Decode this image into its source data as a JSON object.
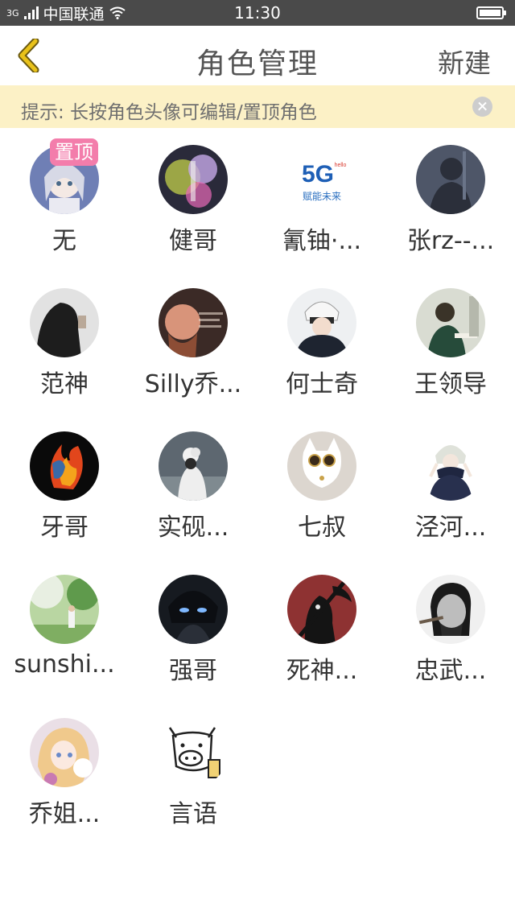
{
  "status_bar": {
    "network_label": "3G",
    "carrier": "中国联通",
    "time": "11:30"
  },
  "nav": {
    "title": "角色管理",
    "new_label": "新建",
    "accent_color": "#e9c21a"
  },
  "tip": {
    "text": "提示: 长按角色头像可编辑/置顶角色",
    "background": "#fcf1c6"
  },
  "roles": [
    {
      "name": "无",
      "badge": "置顶",
      "avatar": "anime-girl"
    },
    {
      "name": "健哥",
      "avatar": "abstract-neon"
    },
    {
      "name": "氰铀·...",
      "avatar": "5g-logo"
    },
    {
      "name": "张rz--...",
      "avatar": "dark-figure"
    },
    {
      "name": "范神",
      "avatar": "hooded-figure"
    },
    {
      "name": "Silly乔...",
      "avatar": "bearded-man"
    },
    {
      "name": "何士奇",
      "avatar": "white-hair-anime"
    },
    {
      "name": "王领导",
      "avatar": "reading-man"
    },
    {
      "name": "牙哥",
      "avatar": "flame-logo"
    },
    {
      "name": "实砚...",
      "avatar": "flower-girl"
    },
    {
      "name": "七叔",
      "avatar": "white-cat"
    },
    {
      "name": "泾河...",
      "avatar": "scarf-anime"
    },
    {
      "name": "sunshi...",
      "avatar": "park-scene"
    },
    {
      "name": "强哥",
      "avatar": "glowing-eyes"
    },
    {
      "name": "死神...",
      "avatar": "reaper"
    },
    {
      "name": "忠武...",
      "avatar": "cigar-man"
    },
    {
      "name": "乔姐...",
      "avatar": "anime-blonde"
    },
    {
      "name": "言语",
      "avatar": "cow-sketch"
    }
  ],
  "five_g": {
    "big": "5G",
    "small": "hello",
    "tagline": "赋能未来"
  }
}
